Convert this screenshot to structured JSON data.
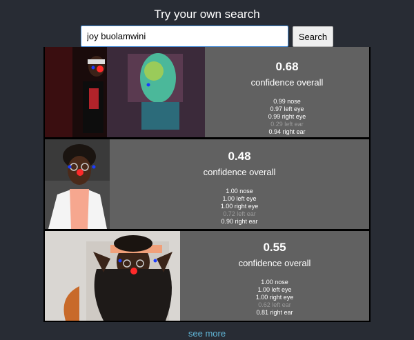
{
  "header": {
    "title": "Try your own search"
  },
  "search": {
    "value": "joy buolamwini",
    "button_label": "Search"
  },
  "results": [
    {
      "score": "0.68",
      "label": "confidence overall",
      "keypoints": [
        {
          "text": "0.99 nose",
          "dim": false
        },
        {
          "text": "0.97 left eye",
          "dim": false
        },
        {
          "text": "0.99 right eye",
          "dim": false
        },
        {
          "text": "0.29 left ear",
          "dim": true
        },
        {
          "text": "0.94 right ear",
          "dim": false
        }
      ]
    },
    {
      "score": "0.48",
      "label": "confidence overall",
      "keypoints": [
        {
          "text": "1.00 nose",
          "dim": false
        },
        {
          "text": "1.00 left eye",
          "dim": false
        },
        {
          "text": "1.00 right eye",
          "dim": false
        },
        {
          "text": "0.72 left ear",
          "dim": true
        },
        {
          "text": "0.90 right ear",
          "dim": false
        }
      ]
    },
    {
      "score": "0.55",
      "label": "confidence overall",
      "keypoints": [
        {
          "text": "1.00 nose",
          "dim": false
        },
        {
          "text": "1.00 left eye",
          "dim": false
        },
        {
          "text": "1.00 right eye",
          "dim": false
        },
        {
          "text": "0.62 left ear",
          "dim": true
        },
        {
          "text": "0.81 right ear",
          "dim": false
        }
      ]
    }
  ],
  "footer": {
    "see_more_label": "see more"
  },
  "colors": {
    "background": "#282c34",
    "card": "#616161",
    "link": "#61b6d7",
    "nose_marker": "#ff2a2a",
    "ear_marker": "#1a3cff"
  }
}
